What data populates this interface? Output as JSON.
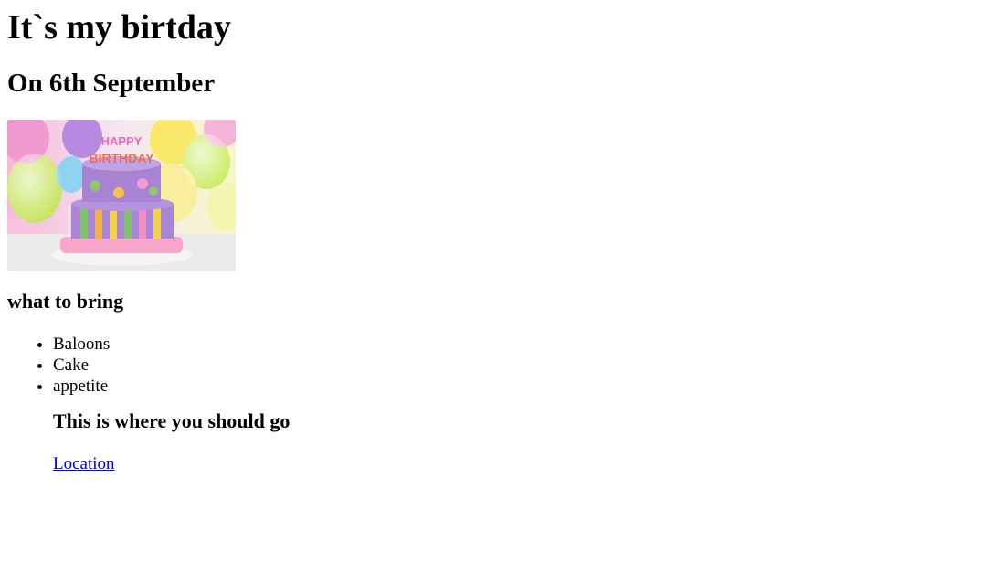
{
  "page": {
    "title": "It`s my birtday",
    "subtitle": "On 6th September",
    "image": {
      "topper_text": "HAPPY BIRTHDAY",
      "icon": "birthday-cake-photo"
    },
    "bring_heading": "what to bring",
    "bring_items": [
      "Baloons",
      "Cake",
      "appetite"
    ],
    "go_heading": "This is where you should go",
    "link_label": "Location",
    "link_color": "#0000ee"
  }
}
